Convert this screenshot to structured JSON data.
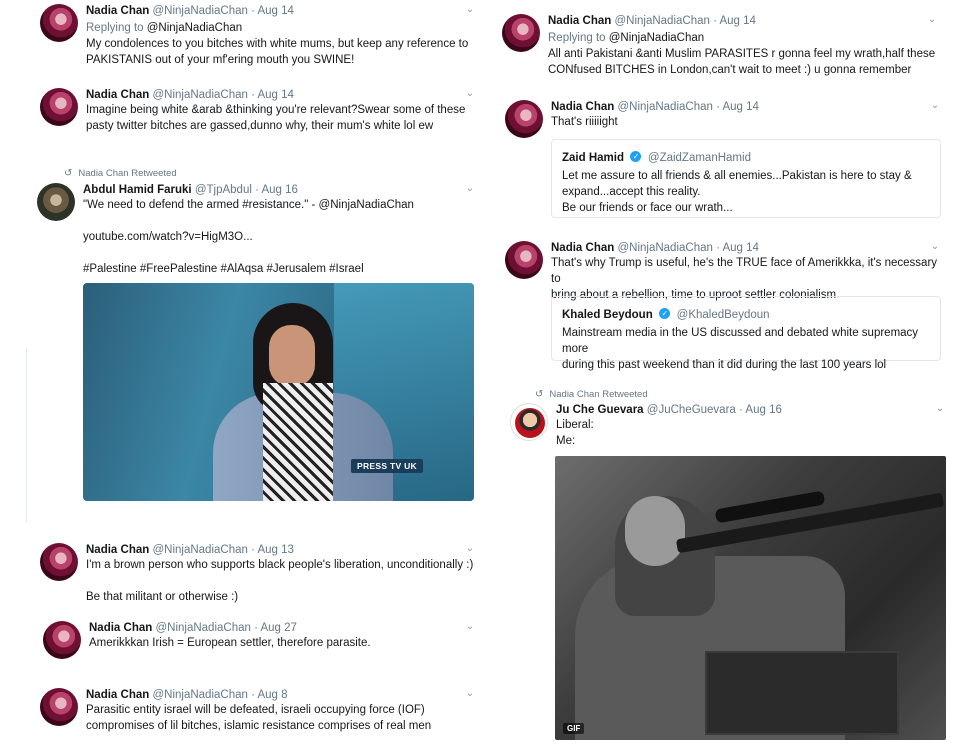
{
  "left_column": [
    {
      "name": "Nadia Chan",
      "handle": "@NinjaNadiaChan",
      "date": "Aug 14",
      "reply_prefix": "Replying to",
      "reply_to": "@NinjaNadiaChan",
      "lines": [
        "My condolences to you bitches with white mums, but keep any reference to",
        "PAKISTANIS out of your mf'ering mouth you SWINE!"
      ]
    },
    {
      "name": "Nadia Chan",
      "handle": "@NinjaNadiaChan",
      "date": "Aug 14",
      "lines": [
        "Imagine being white &arab &thinking you're relevant?Swear some of these",
        "pasty twitter bitches are gassed,dunno why, their mum's white lol ew"
      ]
    },
    {
      "retweet_label": "Nadia Chan Retweeted",
      "name": "Abdul Hamid Faruki",
      "handle": "@TjpAbdul",
      "date": "Aug 16",
      "lines": [
        "\"We need to defend the armed #resistance.\" - @NinjaNadiaChan",
        "",
        "youtube.com/watch?v=HigM3O...",
        "",
        "#Palestine #FreePalestine #AlAqsa #Jerusalem #Israel"
      ],
      "media_logo": "PRESS TV UK"
    },
    {
      "name": "Nadia Chan",
      "handle": "@NinjaNadiaChan",
      "date": "Aug 13",
      "lines": [
        "I'm a brown person who supports black people's liberation, unconditionally :)",
        "",
        "Be that militant or otherwise :)"
      ]
    },
    {
      "name": "Nadia Chan",
      "handle": "@NinjaNadiaChan",
      "date": "Aug 27",
      "lines": [
        "Amerikkkan Irish = European settler, therefore parasite."
      ]
    },
    {
      "name": "Nadia Chan",
      "handle": "@NinjaNadiaChan",
      "date": "Aug 8",
      "lines": [
        "Parasitic entity israel will be defeated, israeli occupying force (IOF)",
        "compromises of lil bitches, islamic resistance comprises of real men"
      ]
    }
  ],
  "right_column": [
    {
      "name": "Nadia Chan",
      "handle": "@NinjaNadiaChan",
      "date": "Aug 14",
      "reply_prefix": "Replying to",
      "reply_to": "@NinjaNadiaChan",
      "lines": [
        "All anti Pakistani &anti Muslim PARASITES r gonna feel my wrath,half these",
        "CONfused BITCHES in London,can't wait to meet :) u gonna remember"
      ]
    },
    {
      "name": "Nadia Chan",
      "handle": "@NinjaNadiaChan",
      "date": "Aug 14",
      "lines": [
        "That's riiiiight"
      ],
      "quote": {
        "name": "Zaid Hamid",
        "handle": "@ZaidZamanHamid",
        "lines": [
          "Let me assure to all friends & all enemies...Pakistan is here to stay &",
          "expand...accept this reality.",
          "Be our friends or face our wrath..."
        ]
      }
    },
    {
      "name": "Nadia Chan",
      "handle": "@NinjaNadiaChan",
      "date": "Aug 14",
      "lines": [
        "That's why Trump is useful, he's the TRUE face of Amerikkka, it's necessary to",
        "bring about a rebellion, time to uproot settler colonialism"
      ],
      "quote": {
        "name": "Khaled Beydoun",
        "handle": "@KhaledBeydoun",
        "lines": [
          "Mainstream media in the US discussed and debated white supremacy more",
          "during this past weekend than it did during the last 100 years lol"
        ]
      }
    },
    {
      "retweet_label": "Nadia Chan Retweeted",
      "name": "Ju Che Guevara",
      "handle": "@JuCheGuevara",
      "date": "Aug 16",
      "lines": [
        "Liberal:",
        "Me:"
      ],
      "media_badge": "GIF"
    }
  ],
  "separator": " · ",
  "icons": {
    "chevron": "chevron-down-icon",
    "retweet": "retweet-icon",
    "verified": "verified-badge-icon"
  },
  "colors": {
    "link_gray": "#657786",
    "verified_blue": "#1da1f2",
    "text": "#14171a"
  }
}
